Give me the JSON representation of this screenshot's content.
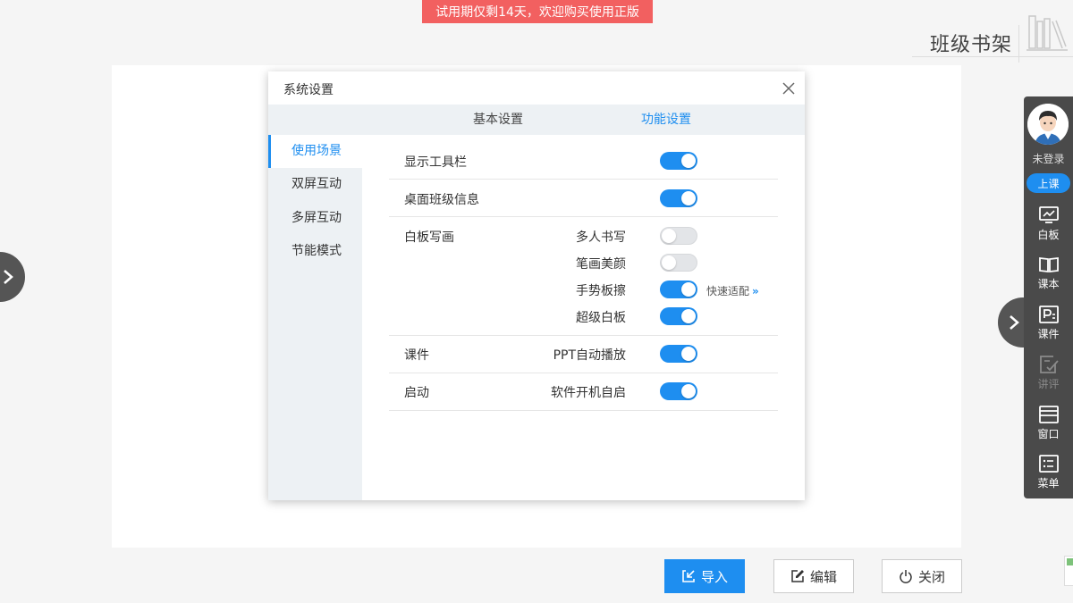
{
  "banner": {
    "text": "试用期仅剩14天，欢迎购买使用正版"
  },
  "header": {
    "title": "班级书架"
  },
  "toolbar": {
    "login_status": "未登录",
    "class_button": "上课",
    "tools": [
      {
        "label": "白板",
        "icon": "whiteboard-icon",
        "enabled": true
      },
      {
        "label": "课本",
        "icon": "book-icon",
        "enabled": true
      },
      {
        "label": "课件",
        "icon": "courseware-icon",
        "enabled": true
      },
      {
        "label": "讲评",
        "icon": "review-icon",
        "enabled": false
      },
      {
        "label": "窗口",
        "icon": "window-icon",
        "enabled": true
      },
      {
        "label": "菜单",
        "icon": "menu-icon",
        "enabled": true
      }
    ]
  },
  "dialog": {
    "title": "系统设置",
    "tabs": [
      {
        "label": "基本设置",
        "active": false
      },
      {
        "label": "功能设置",
        "active": true
      }
    ],
    "sidebar": [
      {
        "label": "使用场景",
        "active": true
      },
      {
        "label": "双屏互动",
        "active": false
      },
      {
        "label": "多屏互动",
        "active": false
      },
      {
        "label": "节能模式",
        "active": false
      }
    ],
    "settings": {
      "show_toolbar": {
        "label": "显示工具栏",
        "on": true
      },
      "desktop_class_info": {
        "label": "桌面班级信息",
        "on": true
      },
      "whiteboard": {
        "label": "白板写画",
        "multi_write": {
          "label": "多人书写",
          "on": false
        },
        "stroke_beauty": {
          "label": "笔画美颜",
          "on": false
        },
        "gesture_erase": {
          "label": "手势板擦",
          "on": true,
          "link": "快速适配"
        },
        "super_board": {
          "label": "超级白板",
          "on": true
        }
      },
      "courseware": {
        "label": "课件",
        "sub_label": "PPT自动播放",
        "on": true
      },
      "startup": {
        "label": "启动",
        "sub_label": "软件开机自启",
        "on": true
      }
    }
  },
  "buttons": {
    "import": "导入",
    "edit": "编辑",
    "close": "关闭"
  },
  "colors": {
    "accent": "#1e8ef0",
    "banner": "#f26060"
  }
}
